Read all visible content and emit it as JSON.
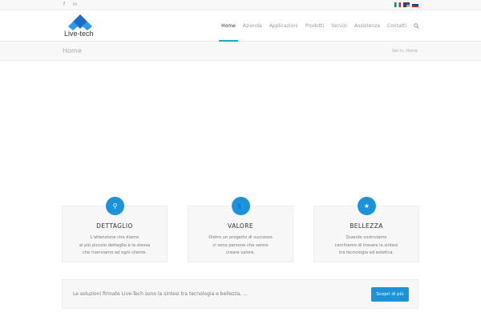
{
  "topbar": {
    "social": [
      "f",
      "in"
    ],
    "languages": [
      "it",
      "en",
      "ru"
    ]
  },
  "header": {
    "logo_text": "Live-tech",
    "nav": [
      "Home",
      "Azienda",
      "Applicazioni",
      "Prodotti",
      "Servizi",
      "Assistenza",
      "Contatti"
    ],
    "active": "Home"
  },
  "titlebar": {
    "title": "Home",
    "breadcrumb": "Sei in: Home"
  },
  "features": [
    {
      "icon": "search-icon",
      "glyph": "⚲",
      "title": "DETTAGLIO",
      "text": "L'attenzione che diamo\nal più piccolo dettaglio è la stessa\nche riserviamo ad ogni cliente."
    },
    {
      "icon": "users-icon",
      "glyph": "👥",
      "title": "VALORE",
      "text": "Dietro un progetto di successo\nci sono persone che sanno\ncreare valore."
    },
    {
      "icon": "star-icon",
      "glyph": "★",
      "title": "BELLEZZA",
      "text": "Quando costruiamo\ncerchiamo di trovare la sintesi\ntra tecnologia ed estetica."
    }
  ],
  "banner": {
    "text": "Le soluzioni firmate Live-Tech sono la sintesi tra tecnologia e bellezza, ...",
    "button": "Scopri di più"
  },
  "colors": {
    "accent": "#1c93d8",
    "nav_underline": "#21aab6"
  }
}
